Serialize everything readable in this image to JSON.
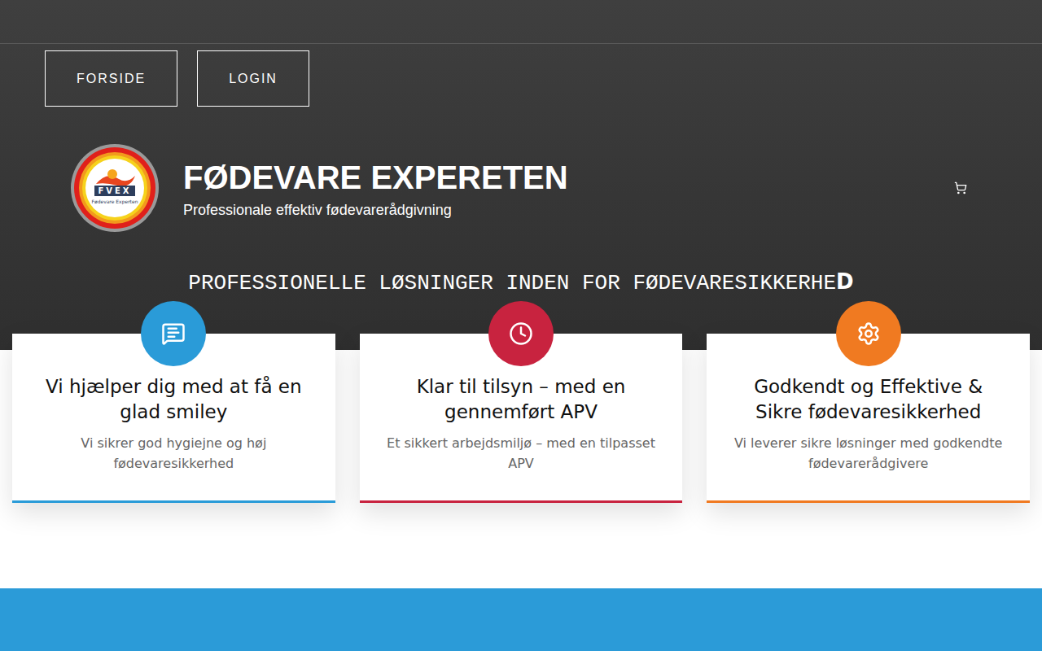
{
  "nav": [
    {
      "label": "FORSIDE"
    },
    {
      "label": "LOGIN"
    }
  ],
  "brand": {
    "title": "FØDEVARE EXPERETEN",
    "subtitle": "Professionale effektiv fødevarerådgivning",
    "logo_top": "FVEX",
    "logo_bottom": "Fødevare Experten"
  },
  "headline": {
    "text": "PROFESSIONELLE LØSNINGER INDEN FOR FØDEVARESIKKERHE",
    "cursor": "D"
  },
  "cards": [
    {
      "icon": "message",
      "title": "Vi hjælper dig med at få en glad smiley",
      "text": "Vi sikrer god hygiejne og høj fødevaresikkerhed",
      "color": "#2a9bd8"
    },
    {
      "icon": "clock",
      "title": "Klar til tilsyn – med en gennemført APV",
      "text": "Et sikkert arbejdsmiljø – med en tilpasset APV",
      "color": "#c8233f"
    },
    {
      "icon": "gear",
      "title": "Godkendt og Effektive & Sikre fødevaresikkerhed",
      "text": "Vi leverer sikre løsninger med godkendte fødevarerådgivere",
      "color": "#f07a21"
    }
  ]
}
